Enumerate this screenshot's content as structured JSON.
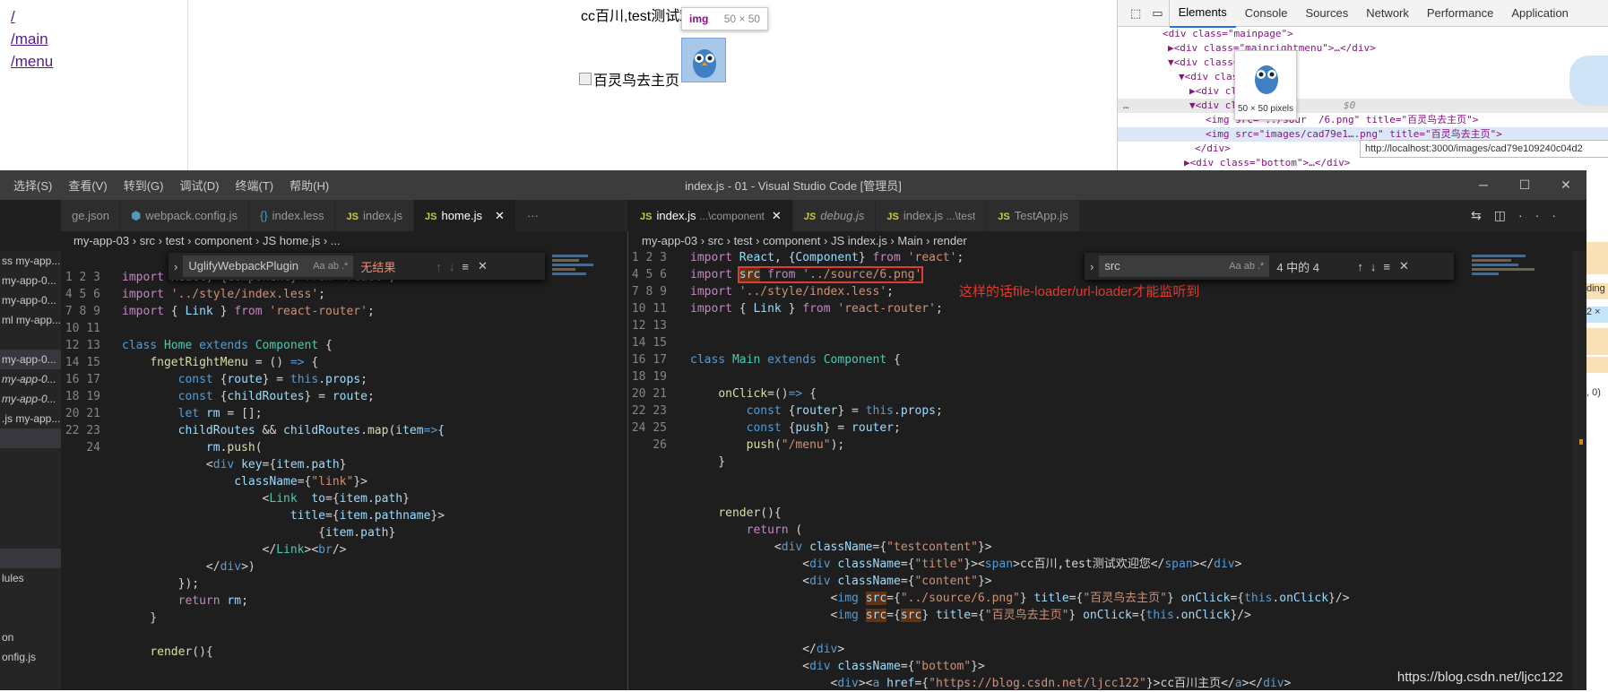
{
  "browser": {
    "nav_links": [
      "/",
      "/main",
      "/menu"
    ],
    "page_title_text": "cc百川,test测试欢迎您",
    "img_alt": "百灵鸟去主页",
    "tooltip_tag": "img",
    "tooltip_size": "50 × 50"
  },
  "devtools": {
    "tabs": [
      "Elements",
      "Console",
      "Sources",
      "Network",
      "Performance",
      "Application"
    ],
    "active_tab": "Elements",
    "dom_lines": [
      "<div class=\"mainpage\">",
      "▶<div class=\"mainrightmenu\">…</div>",
      "▼<div class=\"ma",
      "▼<div class=\"",
      "▶<div class",
      "▼<div class",
      "<img src=\"../sour  /6.png\" title=\"百灵鸟去主页\">",
      "<img src=\"images/cad79e1….png\" title=\"百灵鸟去主页\">",
      "</div>",
      "▶<div class=\"bottom\">…</div>"
    ],
    "img_preview_caption": "50 × 50 pixels",
    "url_tooltip": "http://localhost:3000/images/cad79e109240c04d2",
    "dollar0": "$0"
  },
  "vscode": {
    "menu": [
      "选择(S)",
      "查看(V)",
      "转到(G)",
      "调试(D)",
      "终端(T)",
      "帮助(H)"
    ],
    "window_title": "index.js - 01 - Visual Studio Code [管理员]",
    "left_tabs": [
      {
        "icon": "",
        "label": "ge.json"
      },
      {
        "icon": "gear",
        "label": "webpack.config.js"
      },
      {
        "icon": "{}",
        "label": "index.less"
      },
      {
        "icon": "JS",
        "label": "index.js"
      },
      {
        "icon": "JS",
        "label": "home.js"
      }
    ],
    "right_tabs": [
      {
        "icon": "JS",
        "label": "index.js",
        "suffix": "...\\component"
      },
      {
        "icon": "JS",
        "label": "debug.js",
        "suffix": ""
      },
      {
        "icon": "JS",
        "label": "index.js",
        "suffix": "...\\test"
      },
      {
        "icon": "JS",
        "label": "TestApp.js",
        "suffix": ""
      }
    ],
    "left_breadcrumb": "my-app-03 › src › test › component › JS home.js › ...",
    "right_breadcrumb": "my-app-03 › src › test › component › JS index.js › Main › render",
    "left_find": {
      "value": "UglifyWebpackPlugin",
      "result": "无结果"
    },
    "right_find": {
      "value": "src",
      "result": "4 中的 4"
    },
    "annotation": "这样的话file-loader/url-loader才能监听到",
    "sidebar_items": [
      "ss my-app...",
      "my-app-0...",
      "my-app-0...",
      "ml my-app...",
      "",
      "my-app-0...",
      "my-app-0...",
      "my-app-0...",
      ".js my-app...",
      "",
      "",
      "",
      "",
      "",
      "",
      "",
      "lules",
      "",
      "",
      "",
      "on",
      "onfig.js"
    ],
    "watermark": "https://blog.csdn.net/ljcc122",
    "right_gutter_text": [
      "ding",
      "2 ×",
      ", 0)"
    ]
  }
}
